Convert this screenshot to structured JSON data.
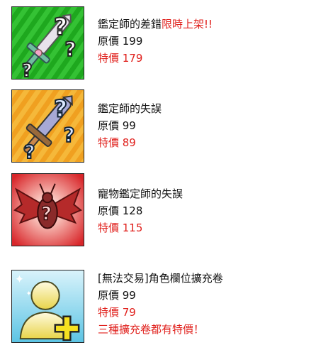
{
  "items": [
    {
      "name": "鑑定師的差錯",
      "tag": "限時上架!!",
      "original": "原價 199",
      "sale": "特價 179",
      "icon": "green-sword-question-icon"
    },
    {
      "name": "鑑定師的失誤",
      "original": "原價 99",
      "sale": "特價 89",
      "icon": "orange-sword-question-icon"
    },
    {
      "name": "寵物鑑定師的失誤",
      "original": "原價 128",
      "sale": "特價 115",
      "icon": "red-winged-question-icon"
    },
    {
      "name": "[無法交易]角色欄位擴充卷",
      "original": "原價 99",
      "sale": "特價 79",
      "note": "三種擴充卷都有特價！",
      "icon": "character-slot-plus-icon"
    }
  ],
  "colors": {
    "sale": "#e0201c",
    "text": "#111111"
  }
}
